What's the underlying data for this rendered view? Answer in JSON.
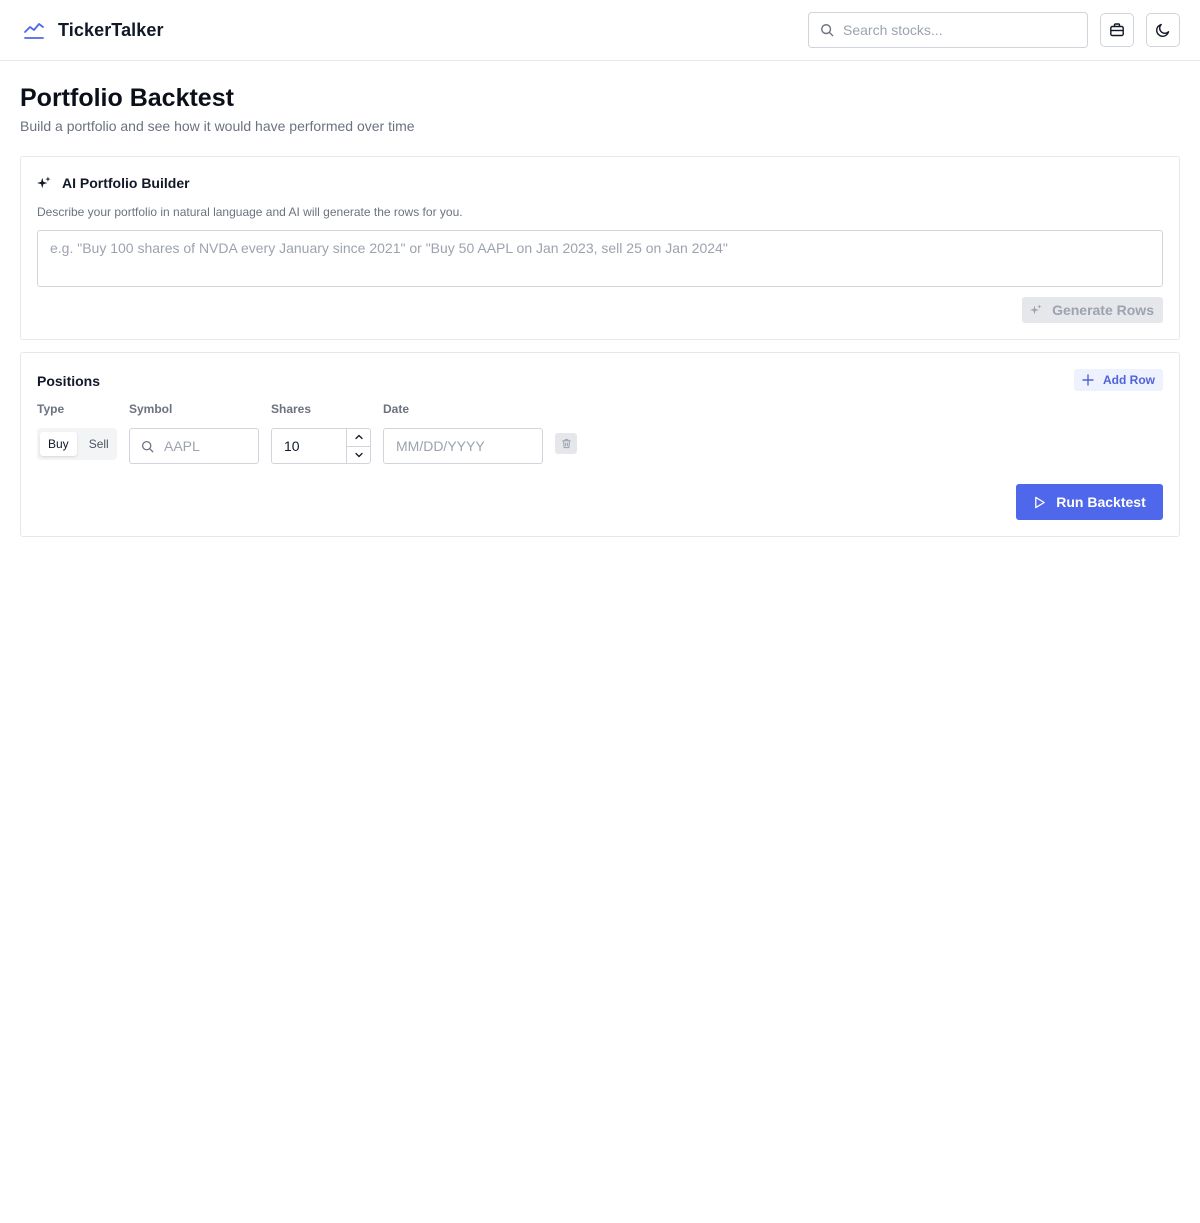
{
  "app": {
    "name": "TickerTalker",
    "logo_icon": "trending-line-icon",
    "accent": "#4f67ea"
  },
  "header": {
    "search_placeholder": "Search stocks...",
    "search_icon": "search-icon",
    "portfolio_icon": "briefcase-icon",
    "theme_icon": "moon-icon"
  },
  "page": {
    "title": "Portfolio Backtest",
    "subtitle": "Build a portfolio and see how it would have performed over time"
  },
  "ai_builder": {
    "icon": "sparkles-icon",
    "title": "AI Portfolio Builder",
    "description": "Describe your portfolio in natural language and AI will generate the rows for you.",
    "prompt_placeholder": "e.g. \"Buy 100 shares of NVDA every January since 2021\" or \"Buy 50 AAPL on Jan 2023, sell 25 on Jan 2024\"",
    "prompt_value": "",
    "generate_label": "Generate Rows",
    "generate_disabled": true
  },
  "positions": {
    "title": "Positions",
    "add_row_label": "Add Row",
    "columns": {
      "type": "Type",
      "symbol": "Symbol",
      "shares": "Shares",
      "date": "Date"
    },
    "rows": [
      {
        "type_options": [
          "Buy",
          "Sell"
        ],
        "type_selected": "Buy",
        "symbol_placeholder": "AAPL",
        "symbol_value": "",
        "shares_value": "10",
        "date_placeholder": "MM/DD/YYYY",
        "date_value": ""
      }
    ],
    "run_label": "Run Backtest"
  }
}
